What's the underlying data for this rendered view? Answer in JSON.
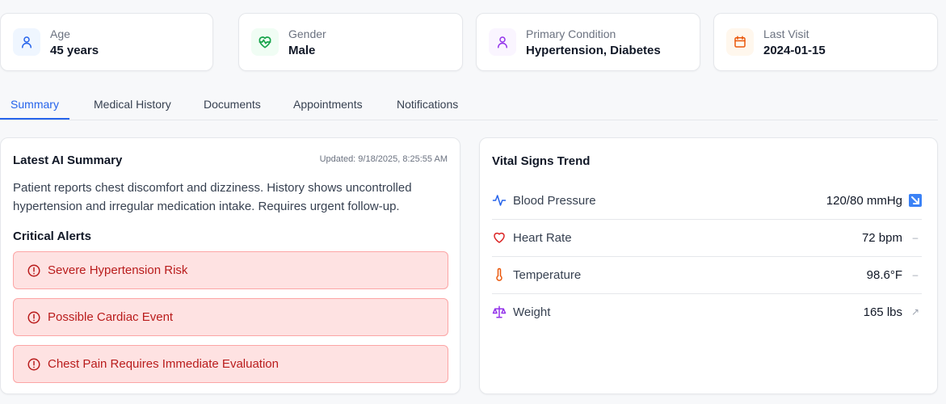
{
  "stats": [
    {
      "label": "Age",
      "value": "45 years",
      "icon": "user-icon"
    },
    {
      "label": "Gender",
      "value": "Male",
      "icon": "heart-pulse-icon"
    },
    {
      "label": "Primary Condition",
      "value": "Hypertension, Diabetes",
      "icon": "person-icon"
    },
    {
      "label": "Last Visit",
      "value": "2024-01-15",
      "icon": "calendar-icon"
    }
  ],
  "tabs": [
    "Summary",
    "Medical History",
    "Documents",
    "Appointments",
    "Notifications"
  ],
  "active_tab": "Summary",
  "summary": {
    "title": "Latest AI Summary",
    "updated": "Updated: 9/18/2025, 8:25:55 AM",
    "text": "Patient reports chest discomfort and dizziness. History shows uncontrolled hypertension and irregular medication intake. Requires urgent follow-up.",
    "alerts_title": "Critical Alerts",
    "alerts": [
      "Severe Hypertension Risk",
      "Possible Cardiac Event",
      "Chest Pain Requires Immediate Evaluation"
    ]
  },
  "vitals": {
    "title": "Vital Signs Trend",
    "rows": [
      {
        "name": "Blood Pressure",
        "value": "120/80 mmHg",
        "icon": "activity-icon",
        "trend": "down"
      },
      {
        "name": "Heart Rate",
        "value": "72 bpm",
        "icon": "heart-icon",
        "trend": "stable"
      },
      {
        "name": "Temperature",
        "value": "98.6°F",
        "icon": "thermometer-icon",
        "trend": "stable"
      },
      {
        "name": "Weight",
        "value": "165 lbs",
        "icon": "scale-icon",
        "trend": "up"
      }
    ],
    "trend_symbols": {
      "stable": "–",
      "up": "↗"
    }
  },
  "colors": {
    "accent": "#2563eb",
    "alert_bg": "#fee2e2",
    "alert_text": "#b91c1c",
    "condition_purple": "#9333ea",
    "calendar_orange": "#ea580c",
    "heart_green": "#16a34a"
  }
}
